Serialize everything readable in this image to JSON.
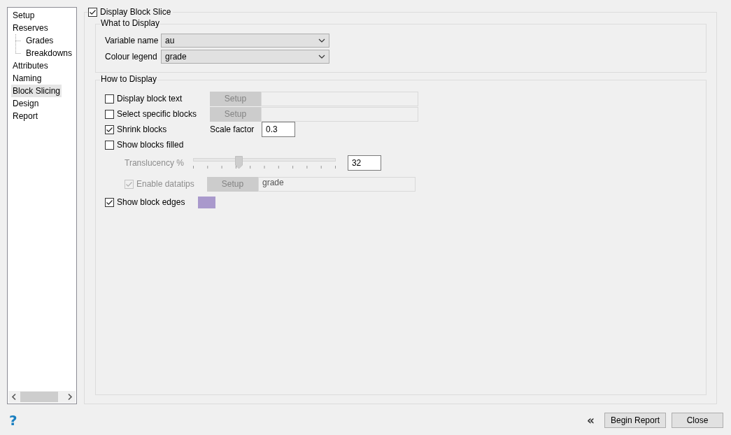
{
  "nav": {
    "items": [
      {
        "label": "Setup",
        "selected": false
      },
      {
        "label": "Reserves",
        "selected": false,
        "children": [
          {
            "label": "Grades",
            "selected": false
          },
          {
            "label": "Breakdowns",
            "selected": false
          }
        ]
      },
      {
        "label": "Attributes",
        "selected": false
      },
      {
        "label": "Naming",
        "selected": false
      },
      {
        "label": "Block Slicing",
        "selected": true
      },
      {
        "label": "Design",
        "selected": false
      },
      {
        "label": "Report",
        "selected": false
      }
    ]
  },
  "display_block_slice": {
    "label": "Display Block Slice",
    "checked": true
  },
  "what_to_display": {
    "title": "What to Display",
    "fields": [
      {
        "label": "Variable name",
        "value": "au"
      },
      {
        "label": "Colour legend",
        "value": "grade"
      }
    ]
  },
  "how_to_display": {
    "title": "How to Display",
    "options": [
      {
        "kind": "setup",
        "label": "Display block text",
        "checked": false,
        "button": "Setup",
        "button_disabled": true
      },
      {
        "kind": "setup",
        "label": "Select specific blocks",
        "checked": false,
        "button": "Setup",
        "button_disabled": true
      },
      {
        "kind": "scale",
        "label": "Shrink blocks",
        "checked": true,
        "field_label": "Scale factor",
        "value": "0.3"
      },
      {
        "kind": "checkbox",
        "label": "Show blocks filled",
        "checked": false
      },
      {
        "kind": "slider",
        "label": "Translucency %",
        "disabled": true,
        "level": 0.32,
        "value": "32"
      },
      {
        "kind": "datatips",
        "label": "Enable datatips",
        "checked": true,
        "disabled": true,
        "button": "Setup",
        "button_disabled": true,
        "value": "grade"
      },
      {
        "kind": "color",
        "label": "Show block edges",
        "checked": true,
        "color": "#a999cc"
      }
    ]
  },
  "footer": {
    "help": "?",
    "collapse": "«",
    "buttons": [
      "Begin Report",
      "Close"
    ]
  }
}
